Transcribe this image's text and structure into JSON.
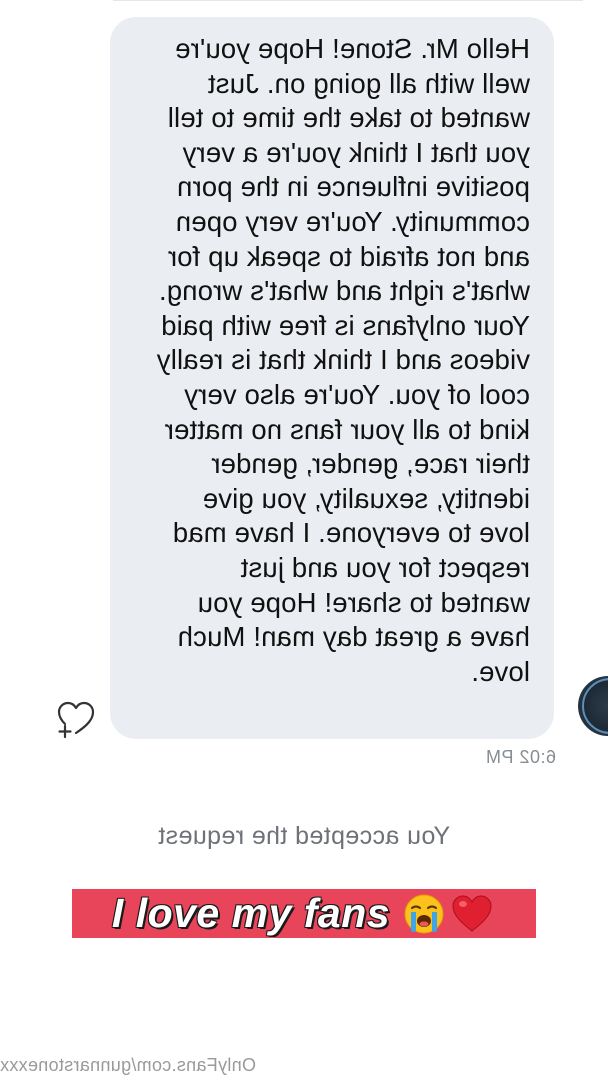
{
  "conversation": {
    "incoming_message": {
      "lines": [
        "Hello Mr. Stone! Hope you're",
        "well with all going on. Just",
        "wanted to take the time to tell",
        "you that I think you're a very",
        "positive influence in the porn",
        "community. You're very open",
        "and not afraid to speak up for",
        "what's right and what's wrong.",
        "Your onlyfans is free with paid",
        "videos and I think that is really",
        "cool of you. You're also very",
        "kind to all your fans no matter",
        "their race, gender, gender",
        "identity, sexuality, you give",
        "love to everyone. I have mad",
        "respect for you and just",
        "wanted to share! Hope you",
        "have a great day man! Much",
        "love."
      ],
      "timestamp": "6:02 PM"
    },
    "system_message": "You accepted the request",
    "icons": {
      "react": "heart-plus-icon",
      "avatar": "avatar"
    }
  },
  "overlay": {
    "caption": "I love my fans",
    "emojis": [
      "loudly-crying-face-emoji",
      "red-heart-emoji"
    ],
    "band_color": "#e8445a"
  },
  "watermark": "OnlyFans.com/gunnarstonexxx"
}
